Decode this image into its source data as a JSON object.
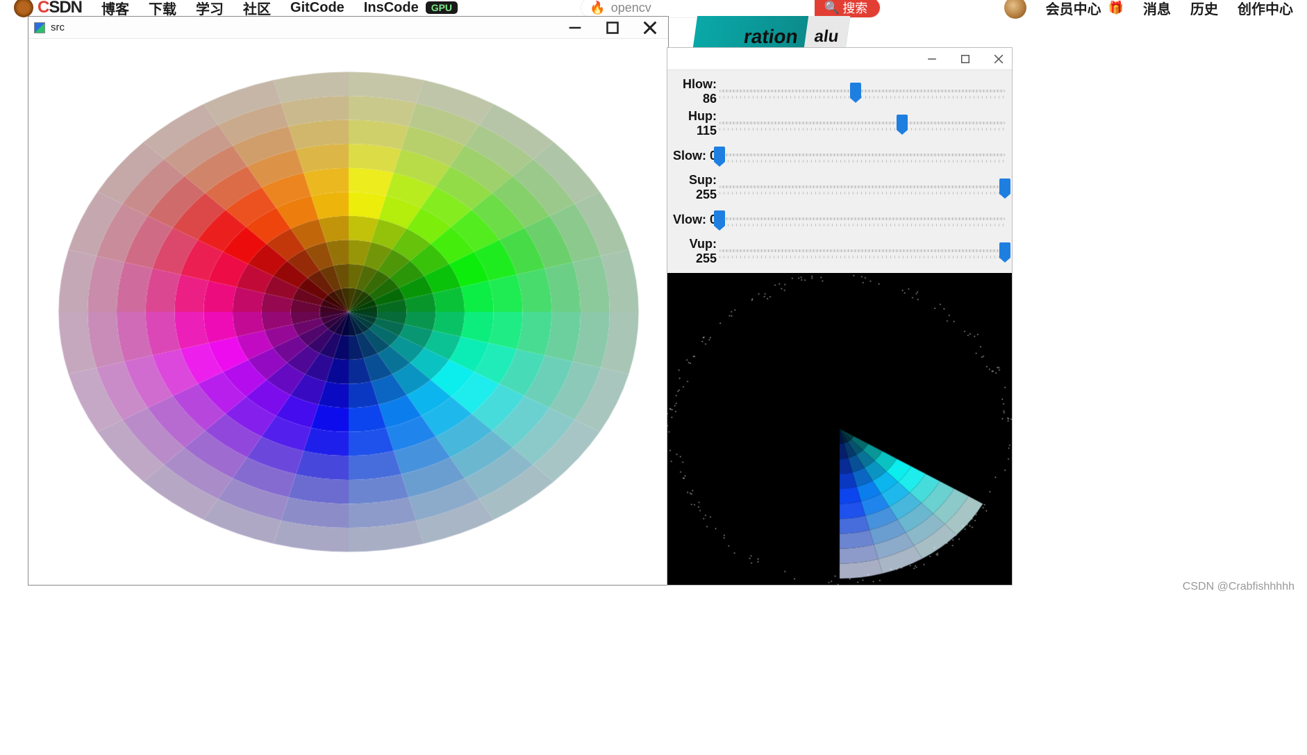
{
  "topnav": {
    "logo_text": "CSDN",
    "links": [
      "博客",
      "下载",
      "学习",
      "社区",
      "GitCode",
      "InsCode"
    ],
    "gpu_badge": "GPU",
    "search_placeholder": "opencv",
    "search_button": "搜索",
    "right_links": [
      "会员中心",
      "消息",
      "历史",
      "创作中心"
    ]
  },
  "src_window": {
    "title": "src"
  },
  "preview_labels": {
    "a": "ration",
    "b": "alu"
  },
  "trackbars": {
    "items": [
      {
        "name": "Hlow",
        "value": 86,
        "max": 180
      },
      {
        "name": "Hup",
        "value": 115,
        "max": 180
      },
      {
        "name": "Slow",
        "value": 0,
        "max": 255
      },
      {
        "name": "Sup",
        "value": 255,
        "max": 255
      },
      {
        "name": "Vlow",
        "value": 0,
        "max": 255
      },
      {
        "name": "Vup",
        "value": 255,
        "max": 255
      }
    ]
  },
  "watermark": "CSDN @Crabfishhhhh",
  "chart_data": {
    "type": "other",
    "description": "HSV color wheel: 24 hue sectors (15° each), 10 rings. Inner ring = low value (dark), outer ring = low saturation (pale). Mask window shows hue range ~86–115 (cyan/blue wedge) passing the HSV inRange filter.",
    "hue_sectors": 24,
    "rings": 10,
    "mask_hue_low": 86,
    "mask_hue_up": 115
  }
}
